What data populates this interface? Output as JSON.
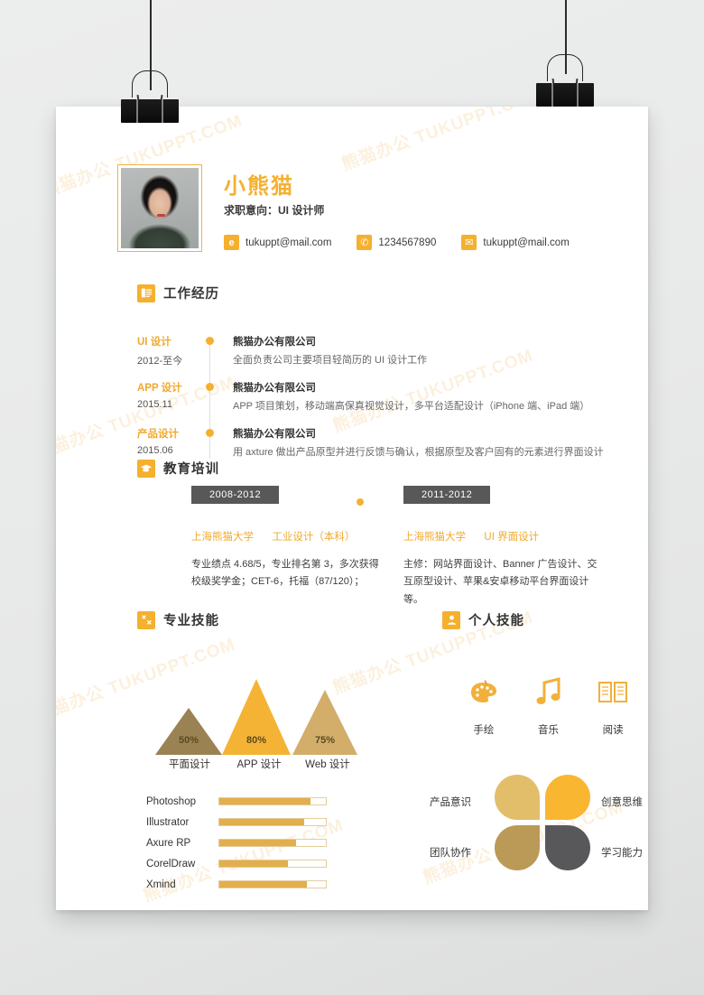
{
  "document": {
    "watermark_text": "熊猫办公 TUKUPPT.COM",
    "paper_color": "#ffffff",
    "accent_color": "#f5b02e",
    "background_color": "#e9eaea"
  },
  "header": {
    "name": "小熊猫",
    "objective": "求职意向：UI 设计师",
    "contacts": [
      {
        "icon": "ie-browser-icon",
        "glyph": "e",
        "value": "tukuppt@mail.com"
      },
      {
        "icon": "phone-icon",
        "glyph": "✆",
        "value": "1234567890"
      },
      {
        "icon": "envelope-icon",
        "glyph": "✉",
        "value": "tukuppt@mail.com"
      }
    ]
  },
  "work": {
    "section_title": "工作经历",
    "section_icon": "document-list-icon",
    "items": [
      {
        "position": "UI 设计",
        "date": "2012-至今",
        "company": "熊猫办公有限公司",
        "description": "全面负责公司主要项目轻简历的 UI 设计工作"
      },
      {
        "position": "APP 设计",
        "date": "2015.11",
        "company": "熊猫办公有限公司",
        "description": "APP 项目策划，移动端高保真视觉设计，多平台适配设计（iPhone 端、iPad 端）"
      },
      {
        "position": "产品设计",
        "date": "2015.06",
        "company": "熊猫办公有限公司",
        "description": "用 axture 做出产品原型并进行反馈与确认，根据原型及客户固有的元素进行界面设计"
      }
    ]
  },
  "education": {
    "section_title": "教育培训",
    "section_icon": "graduation-cap-icon",
    "items": [
      {
        "period": "2008-2012",
        "school": "上海熊猫大学",
        "major": "工业设计（本科）",
        "description": "专业绩点 4.68/5，专业排名第 3，多次获得校级奖学金；CET-6，托福（87/120）；"
      },
      {
        "period": "2011-2012",
        "school": "上海熊猫大学",
        "major": "UI 界面设计",
        "description": "主修：网站界面设计、Banner 广告设计、交互原型设计、苹果&安卓移动平台界面设计等。"
      }
    ]
  },
  "professional_skills": {
    "section_title": "专业技能",
    "section_icon": "tools-icon",
    "chart_data": {
      "type": "bar",
      "title": "专业技能",
      "categories": [
        "平面设计",
        "APP 设计",
        "Web 设计"
      ],
      "values": [
        50,
        80,
        75
      ],
      "labels": [
        "50%",
        "80%",
        "75%"
      ],
      "colors": [
        "#9b8253",
        "#f5b335",
        "#d2ae6a"
      ],
      "ylim": [
        0,
        100
      ],
      "xlabel": "",
      "ylabel": "",
      "grid": false
    },
    "software": {
      "chart_data": {
        "type": "bar",
        "title": "软件技能",
        "categories": [
          "Photoshop",
          "Illustrator",
          "Axure RP",
          "CorelDraw",
          "Xmind"
        ],
        "values": [
          86,
          80,
          72,
          64,
          82
        ],
        "ylim": [
          0,
          100
        ],
        "xlabel": "",
        "ylabel": "",
        "grid": false
      }
    }
  },
  "personal_skills": {
    "section_title": "个人技能",
    "section_icon": "person-icon",
    "hobbies": [
      {
        "icon": "palette-icon",
        "label": "手绘"
      },
      {
        "icon": "music-note-icon",
        "label": "音乐"
      },
      {
        "icon": "open-book-icon",
        "label": "阅读"
      }
    ],
    "traits": [
      {
        "label": "产品意识",
        "color": "#e2bd6a",
        "position": "top-left"
      },
      {
        "label": "创意思维",
        "color": "#f9b631",
        "position": "top-right"
      },
      {
        "label": "团队协作",
        "color": "#bb9a57",
        "position": "bottom-left"
      },
      {
        "label": "学习能力",
        "color": "#58585a",
        "position": "bottom-right"
      }
    ]
  }
}
